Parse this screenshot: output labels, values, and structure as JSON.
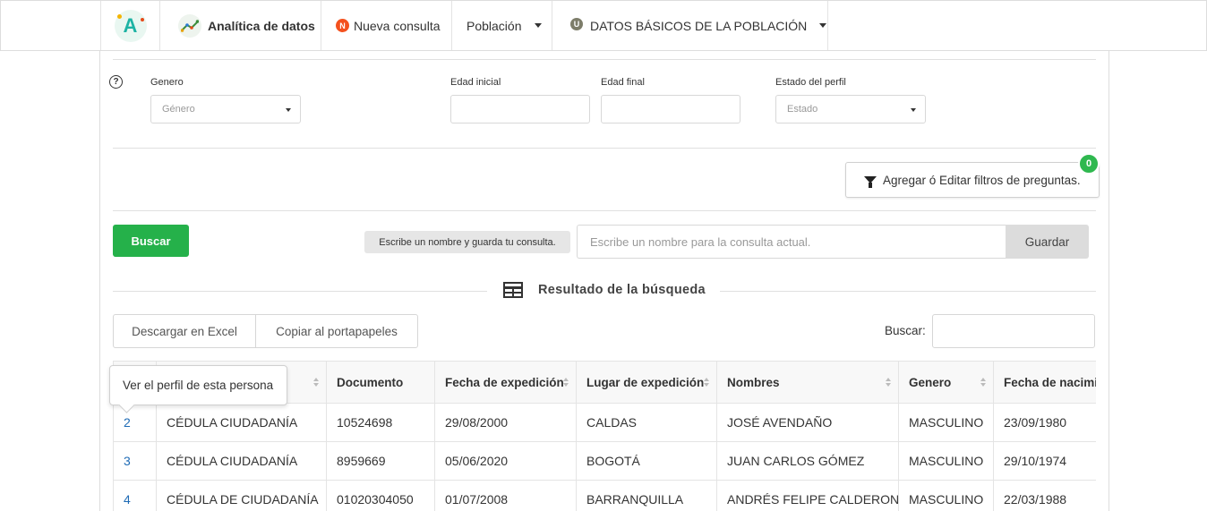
{
  "nav": {
    "logo_letter": "A",
    "analitica": "Analítica de datos",
    "nueva_badge": "N",
    "nueva_consulta": "Nueva consulta",
    "poblacion": "Población",
    "datos_badge": "U",
    "datos_basicos": "DATOS BÁSICOS DE LA POBLACIÓN"
  },
  "filters": {
    "genero_label": "Genero",
    "genero_placeholder": "Género",
    "edad_inicial_label": "Edad inicial",
    "edad_final_label": "Edad final",
    "estado_label": "Estado del perfil",
    "estado_placeholder": "Estado",
    "preguntas_button": "Agregar ó Editar filtros de preguntas.",
    "preguntas_count": "0"
  },
  "actions": {
    "buscar": "Buscar",
    "save_label": "Escribe un nombre y guarda tu consulta.",
    "save_placeholder": "Escribe un nombre para la consulta actual.",
    "guardar": "Guardar"
  },
  "results": {
    "title": "Resultado de la búsqueda",
    "excel": "Descargar en Excel",
    "copiar": "Copiar al portapapeles",
    "buscar_label": "Buscar:",
    "tooltip": "Ver el perfil de esta persona",
    "columns": [
      "",
      "",
      "Documento",
      "Fecha de expedición",
      "Lugar de expedición",
      "Nombres",
      "Genero",
      "Fecha de nacimiento"
    ],
    "rows": [
      [
        "2",
        "CÉDULA CIUDADANÍA",
        "10524698",
        "29/08/2000",
        "CALDAS",
        "JOSÉ AVENDAÑO",
        "MASCULINO",
        "23/09/1980"
      ],
      [
        "3",
        "CÉDULA CIUDADANÍA",
        "8959669",
        "05/06/2020",
        "BOGOTÁ",
        "JUAN CARLOS GÓMEZ",
        "MASCULINO",
        "29/10/1974"
      ],
      [
        "4",
        "CÉDULA DE CIUDADANÍA",
        "01020304050",
        "01/07/2008",
        "BARRANQUILLA",
        "ANDRÉS FELIPE CALDERON",
        "MASCULINO",
        "22/03/1988"
      ]
    ]
  },
  "colors": {
    "green": "#25b14a",
    "link": "#1f6bb5",
    "orange": "#f4511e"
  }
}
